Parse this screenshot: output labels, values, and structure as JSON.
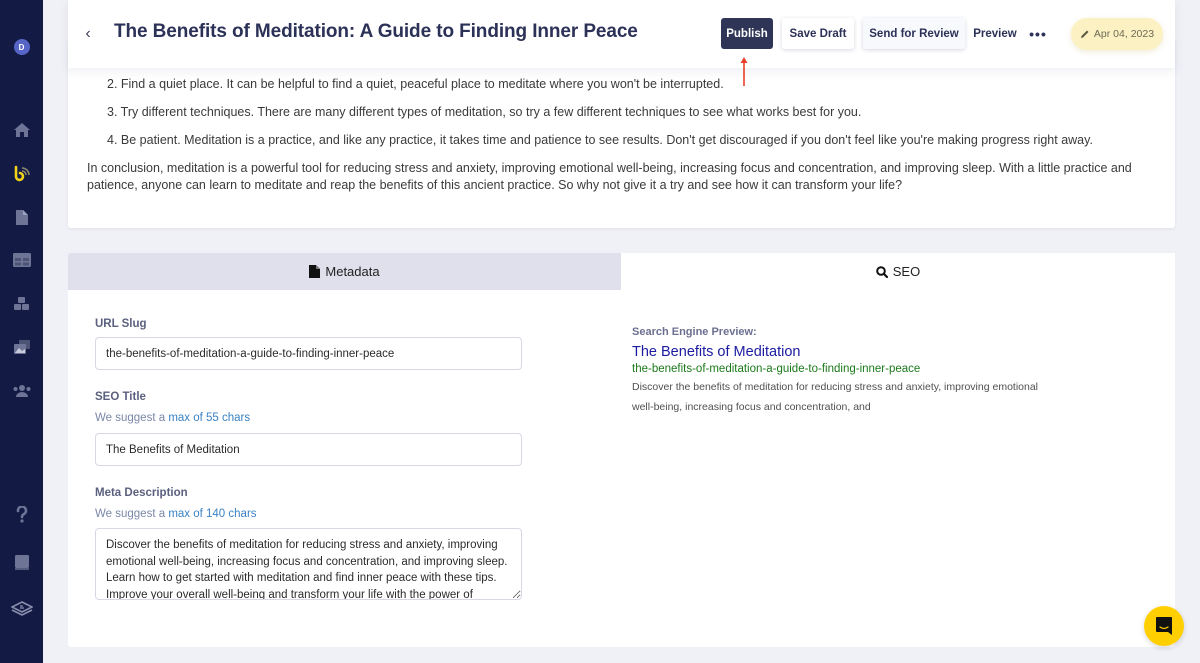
{
  "sidebar": {
    "avatar_initial": "D",
    "items": [
      {
        "name": "home",
        "icon": "home-icon"
      },
      {
        "name": "brand",
        "icon": "brand-logo-icon"
      },
      {
        "name": "documents",
        "icon": "document-icon"
      },
      {
        "name": "layouts",
        "icon": "grid-icon"
      },
      {
        "name": "components",
        "icon": "cubes-icon"
      },
      {
        "name": "media",
        "icon": "media-icon"
      },
      {
        "name": "team",
        "icon": "users-icon"
      },
      {
        "name": "help",
        "icon": "question-icon"
      },
      {
        "name": "docs",
        "icon": "book-icon"
      },
      {
        "name": "apps",
        "icon": "layers-icon"
      }
    ]
  },
  "header": {
    "back_label": "‹",
    "title": "The Benefits of Meditation: A Guide to Finding Inner Peace",
    "buttons": {
      "publish": "Publish",
      "save_draft": "Save Draft",
      "send_for_review": "Send for Review",
      "preview": "Preview",
      "more": "•••"
    },
    "date": "Apr 04, 2023"
  },
  "article": {
    "paragraphs": [
      "2. Find a quiet place. It can be helpful to find a quiet, peaceful place to meditate where you won't be interrupted.",
      "3. Try different techniques. There are many different types of meditation, so try a few different techniques to see what works best for you.",
      "4. Be patient. Meditation is a practice, and like any practice, it takes time and patience to see results. Don't get discouraged if you don't feel like you're making progress right away.",
      "In conclusion, meditation is a powerful tool for reducing stress and anxiety, improving emotional well-being, increasing focus and concentration, and improving sleep. With a little practice and patience, anyone can learn to meditate and reap the benefits of this ancient practice. So why not give it a try and see how it can transform your life?"
    ]
  },
  "tabs": {
    "metadata": "Metadata",
    "seo": "SEO"
  },
  "form": {
    "url_slug": {
      "label": "URL Slug",
      "value": "the-benefits-of-meditation-a-guide-to-finding-inner-peace"
    },
    "seo_title": {
      "label": "SEO Title",
      "hint_prefix": "We suggest a ",
      "hint_accent": "max of 55 chars",
      "value": "The Benefits of Meditation"
    },
    "meta_description": {
      "label": "Meta Description",
      "hint_prefix": "We suggest a ",
      "hint_accent": "max of 140 chars",
      "value": "Discover the benefits of meditation for reducing stress and anxiety, improving emotional well-being, increasing focus and concentration, and improving sleep. Learn how to get started with meditation and find inner peace with these tips. Improve your overall well-being and transform your life with the power of meditation."
    }
  },
  "seo_preview": {
    "label": "Search Engine Preview:",
    "title": "The Benefits of Meditation",
    "url": "the-benefits-of-meditation-a-guide-to-finding-inner-peace",
    "description": "Discover the benefits of meditation for reducing stress and anxiety, improving emotional well-being, increasing focus and concentration, and"
  },
  "colors": {
    "sidebar_bg": "#131b45",
    "primary_button": "#2e3556",
    "date_badge_bg": "#fcf1c2",
    "seo_title": "#1b1aa0",
    "seo_url": "#1b7a1b",
    "hint_accent": "#3b82c4",
    "chat_bubble": "#ffcf00",
    "annotation_arrow": "#e8402a"
  }
}
